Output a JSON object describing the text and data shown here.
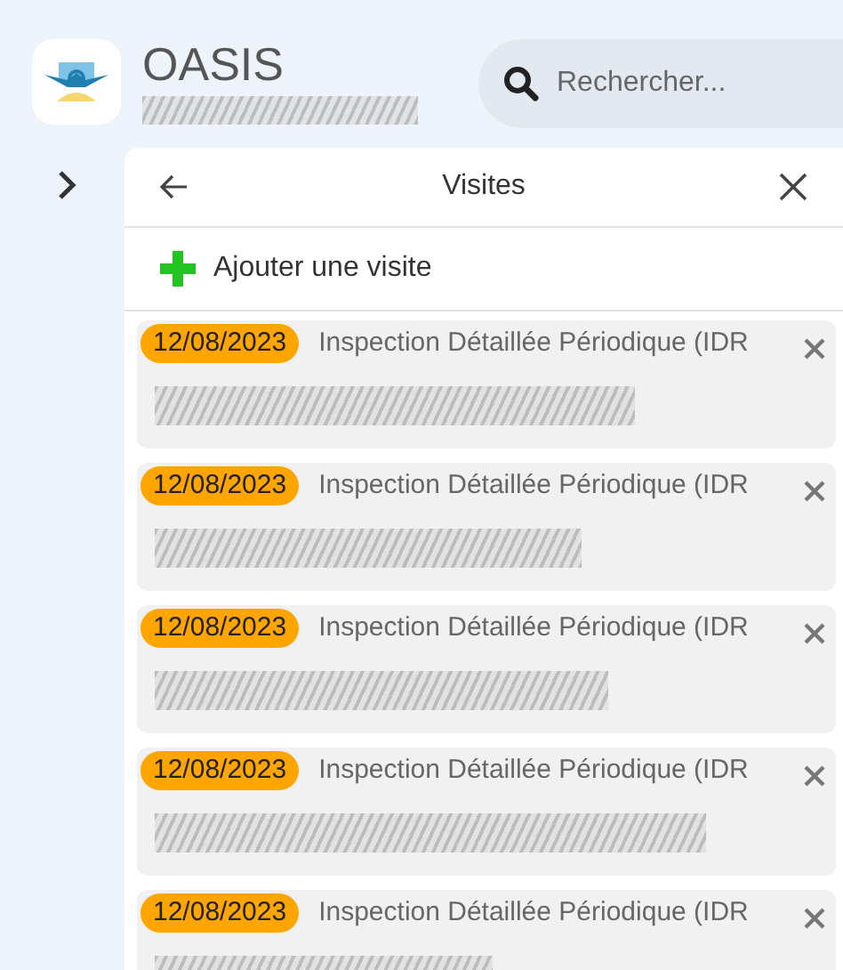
{
  "app": {
    "title": "OASIS"
  },
  "search": {
    "placeholder": "Rechercher..."
  },
  "panel": {
    "title": "Visites",
    "add_label": "Ajouter une visite"
  },
  "visits": [
    {
      "date": "12/08/2023",
      "title": "Inspection Détaillée Périodique (IDR"
    },
    {
      "date": "12/08/2023",
      "title": "Inspection Détaillée Périodique (IDR"
    },
    {
      "date": "12/08/2023",
      "title": "Inspection Détaillée Périodique (IDR"
    },
    {
      "date": "12/08/2023",
      "title": "Inspection Détaillée Périodique (IDR"
    },
    {
      "date": "12/08/2023",
      "title": "Inspection Détaillée Périodique (IDR"
    }
  ]
}
